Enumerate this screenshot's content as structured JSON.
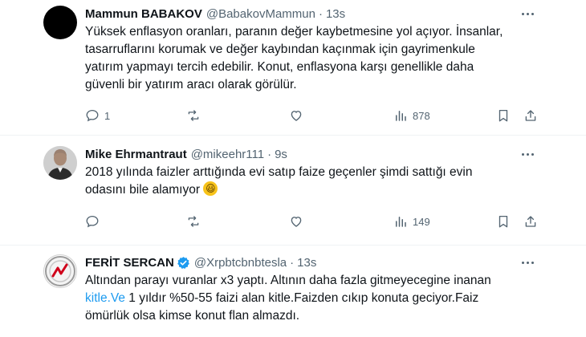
{
  "tweets": [
    {
      "name": "Mammun BABAKOV",
      "handle": "@BabakovMammun",
      "time": "13s",
      "text_lines": [
        "Yüksek enflasyon oranları, paranın değer kaybetmesine yol açıyor. İnsanlar,",
        "tasarruflarını korumak ve değer kaybından kaçınmak için gayrimenkule",
        "yatırım yapmayı tercih edebilir. Konut, enflasyona karşı genellikle daha",
        "güvenli bir yatırım aracı olarak görülür."
      ],
      "replies": "1",
      "retweets": "",
      "likes": "",
      "views": "878",
      "avatar": "black-circle-avatar"
    },
    {
      "name": "Mike Ehrmantraut",
      "handle": "@mikeehr111",
      "time": "9s",
      "text_lines": [
        "2018 yılında faizler arttığında evi satıp faize geçenler şimdi sattığı evin",
        "odasını bile alamıyor"
      ],
      "emoji": "😃",
      "replies": "",
      "retweets": "",
      "likes": "",
      "views": "149",
      "avatar": "bald-man-avatar"
    },
    {
      "name": "FERİT SERCAN",
      "handle": "@Xrpbtcbnbtesla",
      "time": "13s",
      "verified": true,
      "text_lines": [
        "Altından parayı vuranlar x3 yaptı. Altının daha fazla gitmeyecegine inanan",
        "1 yıldır %50-55 faizi alan kitle.Faizden cıkıp konuta geciyor.Faiz",
        "ömürlük olsa kimse konut flan almazdı."
      ],
      "link_text": "kitle.Ve",
      "avatar": "red-logo-avatar"
    }
  ],
  "colors": {
    "text": "#0f1419",
    "muted": "#536471",
    "link": "#1d9bf0",
    "verified": "#1d9bf0",
    "divider": "#eff3f4"
  }
}
